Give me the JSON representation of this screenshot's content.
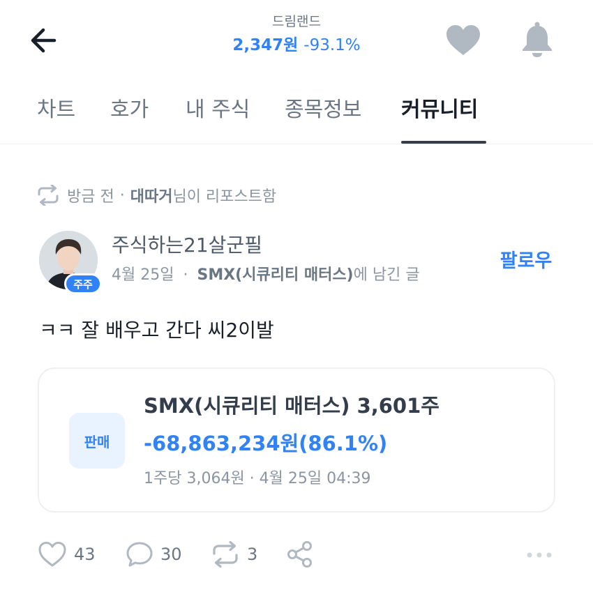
{
  "header": {
    "stock_name": "드림랜드",
    "price": "2,347원",
    "change": "-93.1%"
  },
  "tabs": [
    {
      "label": "차트"
    },
    {
      "label": "호가"
    },
    {
      "label": "내 주식"
    },
    {
      "label": "종목정보"
    },
    {
      "label": "커뮤니티"
    }
  ],
  "active_tab": "커뮤니티",
  "repost": {
    "time": "방금 전",
    "separator": "·",
    "user": "대따거",
    "suffix": "님이 리포스트함"
  },
  "post": {
    "author_name": "주식하는21살군필",
    "badge": "주주",
    "date": "4월 25일",
    "separator": "·",
    "stock": "SMX(시큐리티 매터스)",
    "stock_suffix": "에 남긴 글",
    "follow_label": "팔로우",
    "body": "ㅋㅋ 잘 배우고 간다 씨2이발"
  },
  "trade": {
    "label": "판매",
    "title": "SMX(시큐리티 매터스) 3,601주",
    "profit_loss": "-68,863,234원(86.1%)",
    "detail": "1주당 3,064원 · 4월 25일 04:39"
  },
  "actions": {
    "likes": "43",
    "comments": "30",
    "reposts": "3"
  },
  "icons": {
    "back": "back-arrow-icon",
    "heart": "heart-icon",
    "bell": "bell-icon",
    "repost": "repost-icon",
    "comment": "comment-icon",
    "share": "share-icon",
    "more": "more-icon"
  },
  "colors": {
    "accent": "#3182f6",
    "text_primary": "#191f28",
    "text_secondary": "#6b7684",
    "icon_gray": "#b0b8c1",
    "trade_bg": "#e8f3ff"
  }
}
